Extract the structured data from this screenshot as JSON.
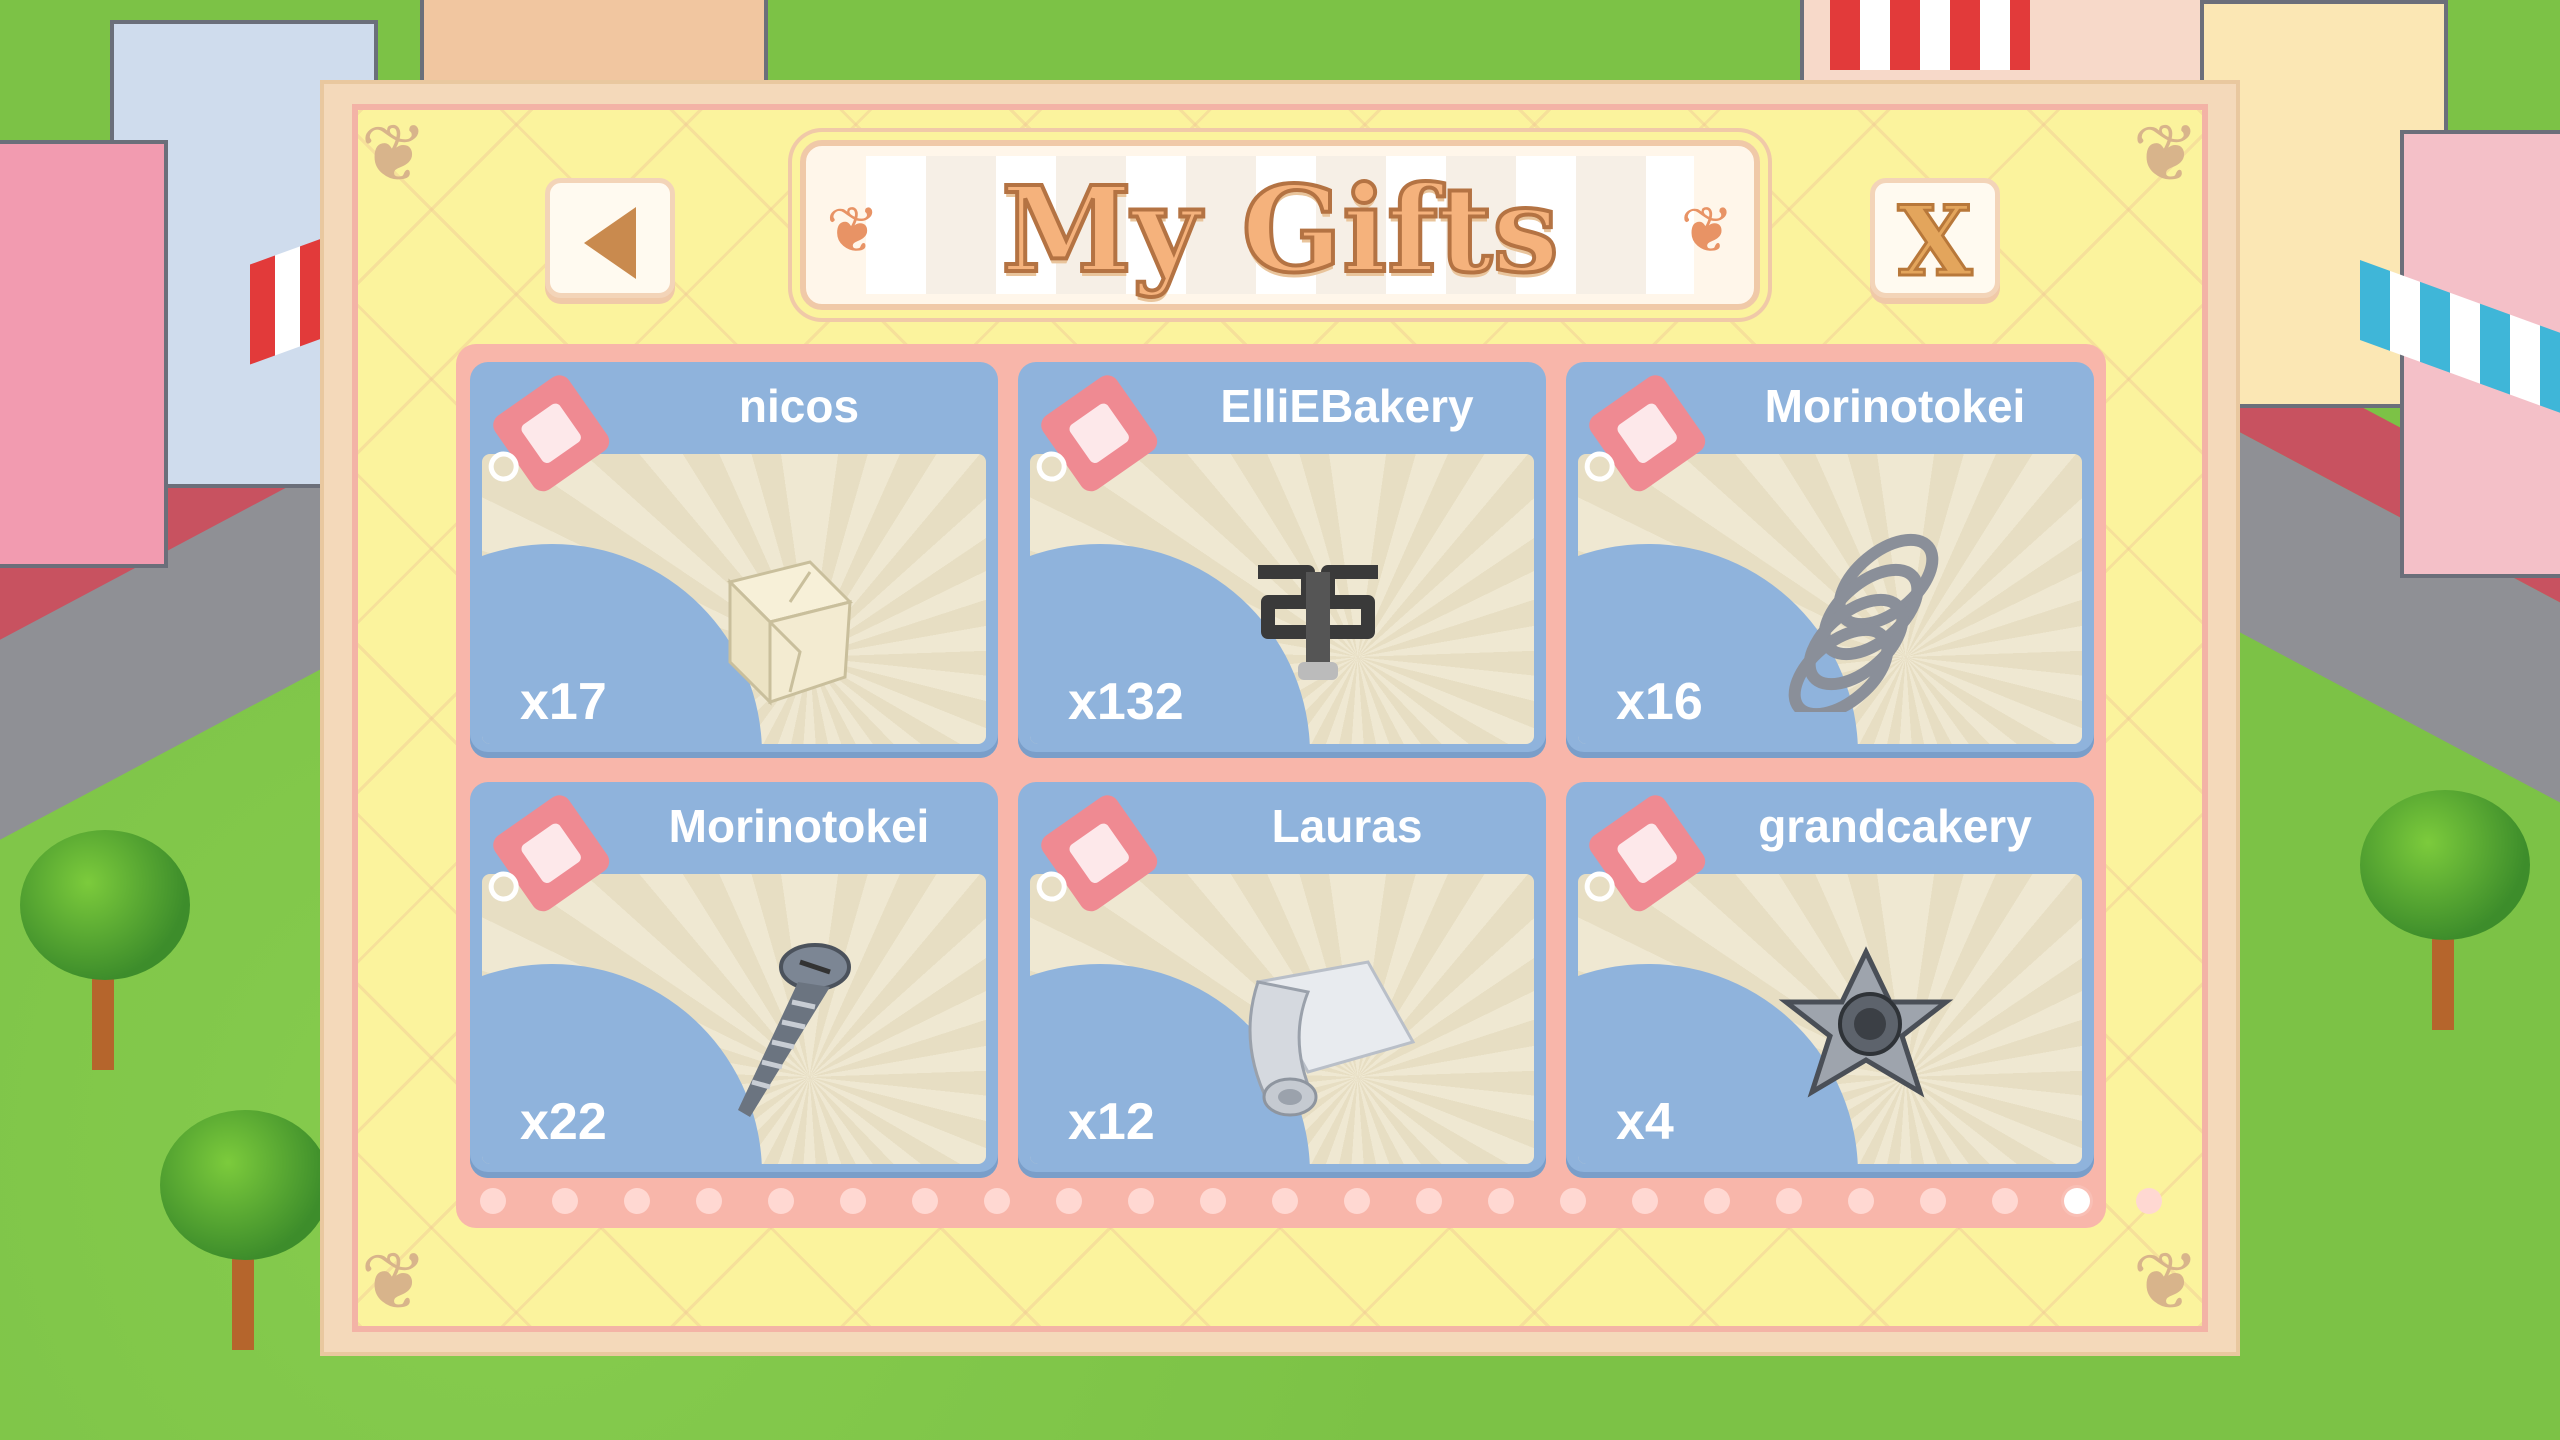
{
  "title": "My Gifts",
  "controls": {
    "close_label": "X"
  },
  "gifts": [
    {
      "sender": "nicos",
      "count": "x17",
      "item_icon": "paper-box-icon"
    },
    {
      "sender": "ElliEBakery",
      "count": "x132",
      "item_icon": "metal-bracket-icon"
    },
    {
      "sender": "Morinotokei",
      "count": "x16",
      "item_icon": "coil-spring-icon"
    },
    {
      "sender": "Morinotokei",
      "count": "x22",
      "item_icon": "screw-icon"
    },
    {
      "sender": "Lauras",
      "count": "x12",
      "item_icon": "metal-sheet-roll-icon"
    },
    {
      "sender": "grandcakery",
      "count": "x4",
      "item_icon": "star-nut-icon"
    }
  ],
  "pagination": {
    "total_pages": 24,
    "current_page": 23
  }
}
